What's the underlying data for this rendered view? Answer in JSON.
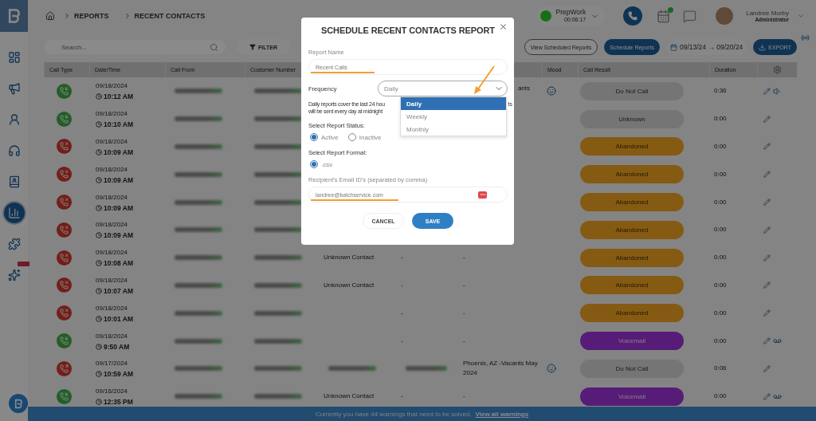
{
  "sidebar": {
    "items": [
      {
        "kind": "dashboard",
        "selected": false
      },
      {
        "kind": "campaigns",
        "selected": false
      },
      {
        "kind": "agents",
        "selected": false
      },
      {
        "kind": "support",
        "selected": false
      },
      {
        "kind": "directory",
        "selected": false
      },
      {
        "kind": "reports",
        "selected": true
      },
      {
        "kind": "integrations",
        "selected": false
      },
      {
        "kind": "ai",
        "selected": false
      }
    ]
  },
  "breadcrumb": [
    "REPORTS",
    "RECENT CONTACTS"
  ],
  "status": {
    "name": "PrepWork",
    "timer": "00:06:17"
  },
  "user": {
    "name": "Landree Morby",
    "role": "Administrator"
  },
  "toolbar": {
    "search_placeholder": "Search...",
    "filter": "FILTER",
    "view_scheduled": "View Scheduled Reports",
    "schedule": "Schedule Reports",
    "date_range": "09/13/24 → 09/20/24",
    "export": "EXPORT"
  },
  "table": {
    "columns": [
      "Call Type",
      "Date/Time",
      "Call From",
      "Customer Number",
      "Mood",
      "Call Result",
      "Duration"
    ],
    "rows": [
      {
        "kind": "inbound",
        "date": "09/18/2024",
        "time": "10:12 AM",
        "campaign": {
          "kind": "partial",
          "text": "ants"
        },
        "mood": true,
        "result": {
          "kind": "gray",
          "text": "Do Not Call"
        },
        "duration": "0:36",
        "actions": [
          {
            "kind": "edit"
          },
          {
            "kind": "audio"
          }
        ]
      },
      {
        "kind": "inbound",
        "date": "09/18/2024",
        "time": "10:10 AM",
        "mood": false,
        "result": {
          "kind": "gray",
          "text": "Unknown"
        },
        "duration": "0:00",
        "actions": [
          {
            "kind": "edit"
          }
        ]
      },
      {
        "kind": "missed",
        "date": "09/18/2024",
        "time": "10:09 AM",
        "mood": false,
        "result": {
          "kind": "orange",
          "text": "Abandoned"
        },
        "duration": "0:00",
        "actions": [
          {
            "kind": "edit"
          }
        ]
      },
      {
        "kind": "missed",
        "date": "09/18/2024",
        "time": "10:09 AM",
        "mood": false,
        "result": {
          "kind": "orange",
          "text": "Abandoned"
        },
        "duration": "0:00",
        "actions": [
          {
            "kind": "edit"
          }
        ]
      },
      {
        "kind": "missed",
        "date": "09/18/2024",
        "time": "10:09 AM",
        "mood": false,
        "result": {
          "kind": "orange",
          "text": "Abandoned"
        },
        "duration": "0:00",
        "actions": [
          {
            "kind": "edit"
          }
        ]
      },
      {
        "kind": "missed",
        "date": "09/18/2024",
        "time": "10:09 AM",
        "mood": false,
        "result": {
          "kind": "orange",
          "text": "Abandoned"
        },
        "duration": "0:00",
        "actions": [
          {
            "kind": "edit"
          }
        ]
      },
      {
        "kind": "missed",
        "date": "09/18/2024",
        "time": "10:08 AM",
        "contact": {
          "kind": "text",
          "text": "Unknown Contact"
        },
        "column_5": {
          "kind": "text",
          "text": "-"
        },
        "campaign": {
          "kind": "text",
          "text": "-"
        },
        "mood": false,
        "result": {
          "kind": "orange",
          "text": "Abandoned"
        },
        "duration": "0:00",
        "actions": [
          {
            "kind": "edit"
          }
        ]
      },
      {
        "kind": "missed",
        "date": "09/18/2024",
        "time": "10:07 AM",
        "contact": {
          "kind": "text",
          "text": "Unknown Contact"
        },
        "column_5": {
          "kind": "text",
          "text": "-"
        },
        "campaign": {
          "kind": "text",
          "text": "-"
        },
        "mood": false,
        "result": {
          "kind": "orange",
          "text": "Abandoned"
        },
        "duration": "0:00",
        "actions": [
          {
            "kind": "edit"
          }
        ]
      },
      {
        "kind": "missed",
        "date": "09/18/2024",
        "time": "10:01 AM",
        "column_5": {
          "kind": "text",
          "text": "-"
        },
        "campaign": {
          "kind": "text",
          "text": "-"
        },
        "mood": false,
        "result": {
          "kind": "orange",
          "text": "Abandoned"
        },
        "duration": "0:00",
        "actions": [
          {
            "kind": "edit"
          }
        ]
      },
      {
        "kind": "inbound",
        "date": "09/18/2024",
        "time": "9:50 AM",
        "column_5": {
          "kind": "text",
          "text": "-"
        },
        "campaign": {
          "kind": "text",
          "text": "-"
        },
        "mood": false,
        "result": {
          "kind": "purple",
          "text": "Voicemail"
        },
        "duration": "0:00",
        "actions": [
          {
            "kind": "edit"
          },
          {
            "kind": "voicemail"
          }
        ]
      },
      {
        "kind": "outbound",
        "date": "09/17/2024",
        "time": "10:59 AM",
        "contact": {
          "kind": "redacted"
        },
        "column_5": {
          "kind": "redacted"
        },
        "campaign": {
          "kind": "text",
          "text": "Phoenix, AZ -Vacants May 2024"
        },
        "mood": true,
        "result": {
          "kind": "gray",
          "text": "Do Not Call"
        },
        "duration": "0:06",
        "actions": [
          {
            "kind": "edit"
          }
        ]
      },
      {
        "kind": "inbound",
        "date": "09/16/2024",
        "time": "12:35 PM",
        "contact": {
          "kind": "text",
          "text": "Unknown Contact"
        },
        "column_5": {
          "kind": "text",
          "text": "-"
        },
        "campaign": {
          "kind": "text",
          "text": "-"
        },
        "mood": false,
        "result": {
          "kind": "purple",
          "text": "Voicemail"
        },
        "duration": "0:00",
        "actions": [
          {
            "kind": "edit"
          },
          {
            "kind": "voicemail"
          }
        ]
      }
    ]
  },
  "banner": {
    "text": "Currently you have 44 warnings that need to be solved.",
    "link": "View all warnings"
  },
  "dialog": {
    "title": "SCHEDULE RECENT CONTACTS REPORT",
    "report_name": {
      "label": "Report Name",
      "value": "Recent Calls"
    },
    "frequency": {
      "label": "Frequency",
      "value": "Daily",
      "expanded": true,
      "options": [
        {
          "label": "Daily",
          "selected": true
        },
        {
          "label": "Weekly",
          "selected": false
        },
        {
          "label": "Monthly",
          "selected": false
        }
      ]
    },
    "help_text": [
      "Daily reports cover the last 24 hou",
      "will be sent every day at midnight"
    ],
    "help_text_tail": "ts",
    "status": {
      "label": "Select Report Status:",
      "options": [
        {
          "label": "Active",
          "selected": true
        },
        {
          "label": "Inactive",
          "selected": false
        }
      ]
    },
    "format": {
      "label": "Select Report Format:",
      "options": [
        {
          "label": ".csv",
          "selected": true
        }
      ]
    },
    "email": {
      "label": "Recipient's Email ID's (separated by comma)",
      "value": "landree@batchservice.com"
    },
    "buttons": [
      {
        "kind": "secondary",
        "label": "CANCEL"
      },
      {
        "kind": "primary",
        "label": "SAVE"
      }
    ]
  }
}
